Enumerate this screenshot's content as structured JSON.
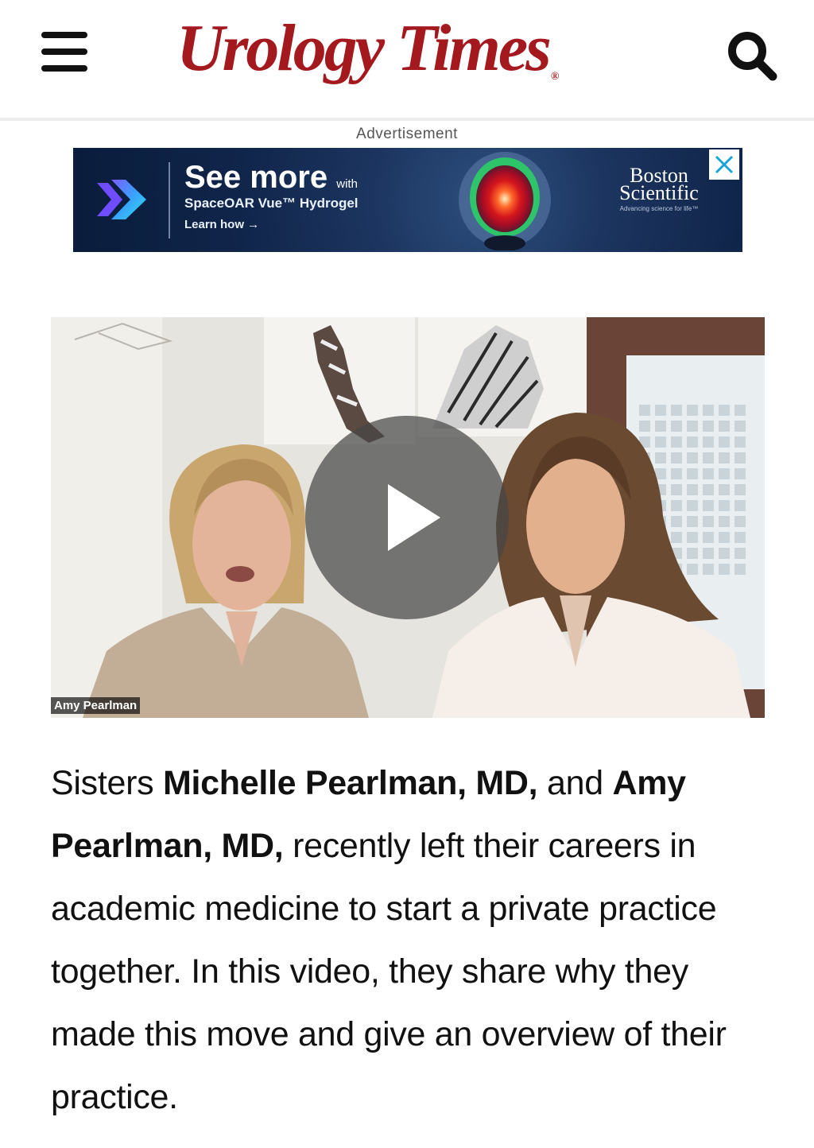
{
  "header": {
    "logo_text": "Urology Times",
    "logo_mark": "®",
    "menu_icon": "hamburger-menu-icon",
    "search_icon": "search-icon",
    "brand_color": "#a3191e"
  },
  "ad": {
    "label": "Advertisement",
    "headline": "See more",
    "headline_suffix": "with",
    "product": "SpaceOAR Vue™ Hydrogel",
    "cta": "Learn how →",
    "brand": "Boston Scientific",
    "brand_tagline": "Advancing science for life™",
    "close_icon": "close-icon"
  },
  "video": {
    "name_tag": "Amy Pearlman",
    "play_icon": "play-icon"
  },
  "article": {
    "t1": "Sisters ",
    "b1": "Michelle Pearlman, MD,",
    "t2": " and ",
    "b2": "Amy Pearlman, MD,",
    "t3": " recently left their careers in academic medicine to start a private practice together. In this video, they share why they made this move and give an overview of their practice."
  }
}
